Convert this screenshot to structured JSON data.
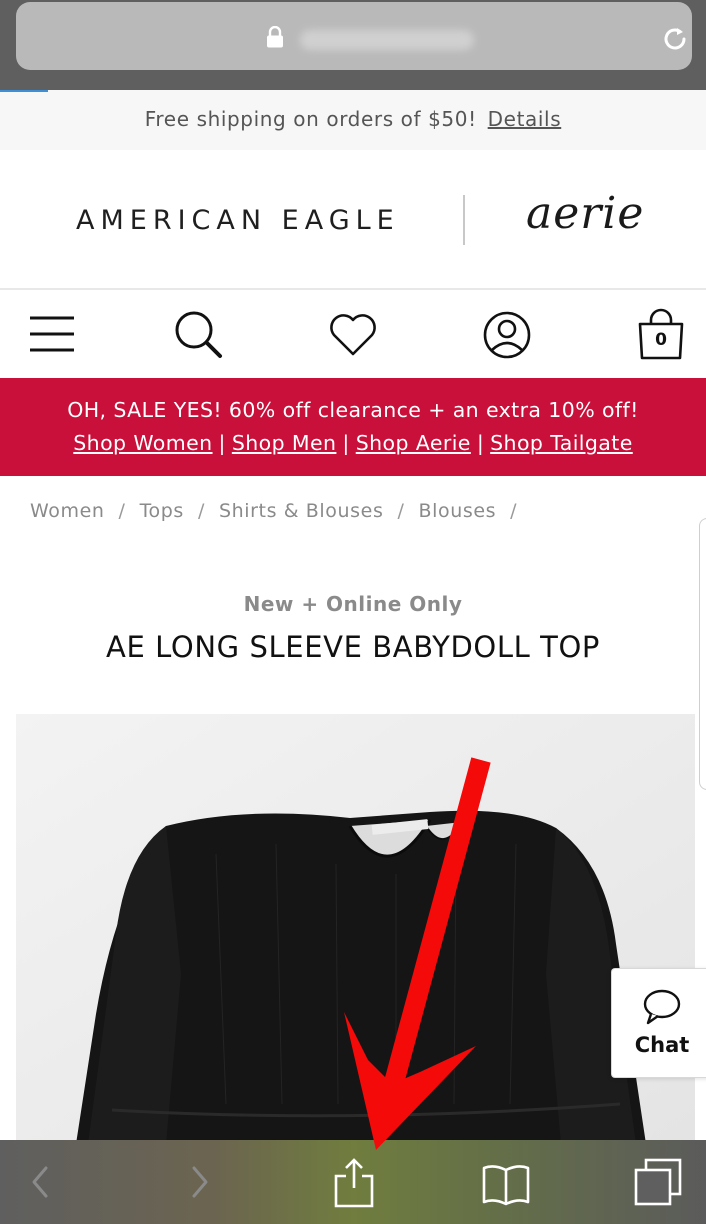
{
  "browser": {
    "url_blurred": true,
    "icons": {
      "lock": "lock-icon",
      "reload": "reload-icon"
    }
  },
  "shipping": {
    "text": "Free shipping on orders of $50!",
    "link": "Details"
  },
  "brands": {
    "left": "AMERICAN EAGLE",
    "right": "aerie"
  },
  "header_icons": {
    "menu": "menu-icon",
    "search": "search-icon",
    "wishlist": "heart-icon",
    "account": "account-icon",
    "cart": "bag-icon",
    "cart_count": "0"
  },
  "sale_banner": {
    "headline": "OH, SALE YES! 60% off clearance + an extra 10% off!",
    "links": [
      "Shop Women",
      "Shop Men",
      "Shop Aerie",
      "Shop Tailgate"
    ],
    "separator": "|",
    "color": "#c9103a"
  },
  "breadcrumb": {
    "items": [
      "Women",
      "Tops",
      "Shirts & Blouses",
      "Blouses"
    ],
    "separator": "/"
  },
  "product": {
    "badge": "New + Online Only",
    "title": "AE LONG SLEEVE BABYDOLL TOP"
  },
  "chat": {
    "label": "Chat"
  },
  "toolbar": {
    "icons": [
      "back-icon",
      "forward-icon",
      "share-icon",
      "bookmarks-icon",
      "tabs-icon"
    ]
  }
}
